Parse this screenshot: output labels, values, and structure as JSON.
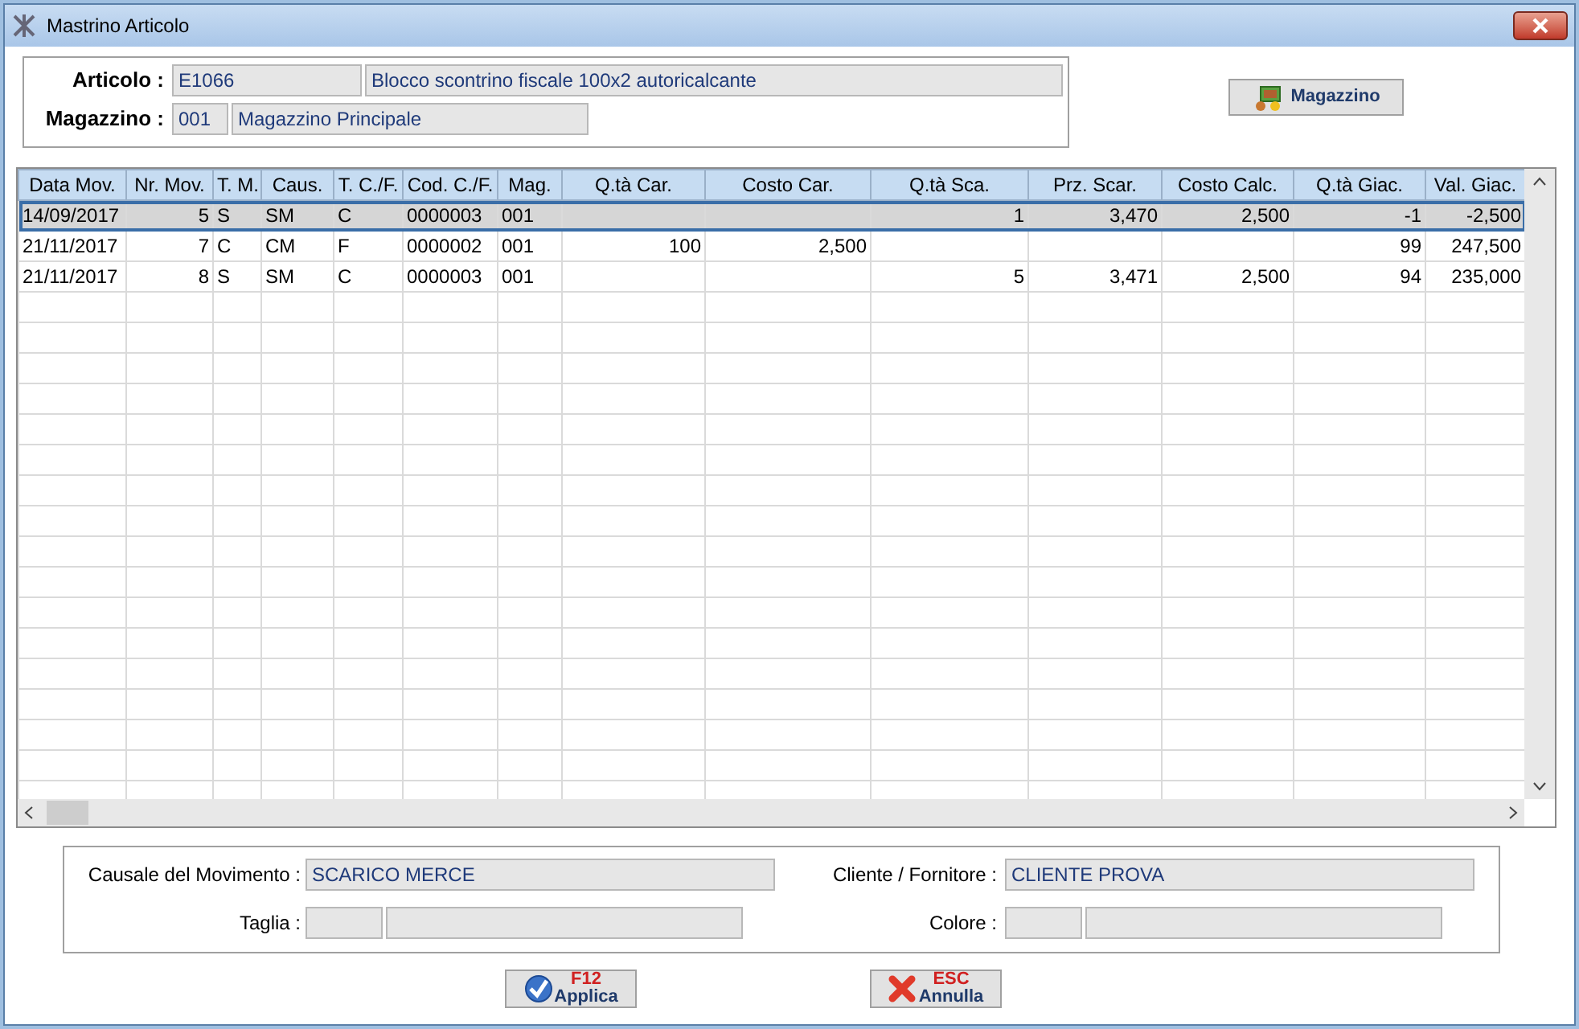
{
  "window": {
    "title": "Mastrino Articolo"
  },
  "header": {
    "fields": [
      {
        "label": "Articolo :",
        "code": "E1066",
        "description": "Blocco scontrino fiscale 100x2 autoricalcante"
      },
      {
        "label": "Magazzino :",
        "code": "001",
        "description": "Magazzino Principale"
      }
    ],
    "magazzino_button": "Magazzino"
  },
  "table": {
    "columns": [
      {
        "label": "Data Mov.",
        "kind": "text"
      },
      {
        "label": "Nr. Mov.",
        "kind": "number"
      },
      {
        "label": "T. M.",
        "kind": "text"
      },
      {
        "label": "Caus.",
        "kind": "text"
      },
      {
        "label": "T. C./F.",
        "kind": "text"
      },
      {
        "label": "Cod. C./F.",
        "kind": "text"
      },
      {
        "label": "Mag.",
        "kind": "text"
      },
      {
        "label": "Q.tà Car.",
        "kind": "number"
      },
      {
        "label": "Costo Car.",
        "kind": "number"
      },
      {
        "label": "Q.tà Sca.",
        "kind": "number"
      },
      {
        "label": "Prz. Scar.",
        "kind": "number"
      },
      {
        "label": "Costo Calc.",
        "kind": "number"
      },
      {
        "label": "Q.tà Giac.",
        "kind": "number"
      },
      {
        "label": "Val. Giac.",
        "kind": "number"
      }
    ],
    "rows": [
      {
        "selected": true,
        "cells": [
          "14/09/2017",
          "5",
          "S",
          "SM",
          "C",
          "0000003",
          "001",
          "",
          "",
          "1",
          "3,470",
          "2,500",
          "-1",
          "-2,500"
        ]
      },
      {
        "selected": false,
        "cells": [
          "21/11/2017",
          "7",
          "C",
          "CM",
          "F",
          "0000002",
          "001",
          "100",
          "2,500",
          "",
          "",
          "",
          "99",
          "247,500"
        ]
      },
      {
        "selected": false,
        "cells": [
          "21/11/2017",
          "8",
          "S",
          "SM",
          "C",
          "0000003",
          "001",
          "",
          "",
          "5",
          "3,471",
          "2,500",
          "94",
          "235,000"
        ]
      }
    ]
  },
  "details": {
    "causale_label": "Causale del Movimento :",
    "causale_value": "SCARICO MERCE",
    "cliente_label": "Cliente / Fornitore :",
    "cliente_value": "CLIENTE PROVA",
    "taglia_label": "Taglia :",
    "colore_label": "Colore :"
  },
  "buttons": [
    {
      "kind": "apply",
      "key": "F12",
      "label": "Applica"
    },
    {
      "kind": "cancel",
      "key": "ESC",
      "label": "Annulla"
    }
  ]
}
